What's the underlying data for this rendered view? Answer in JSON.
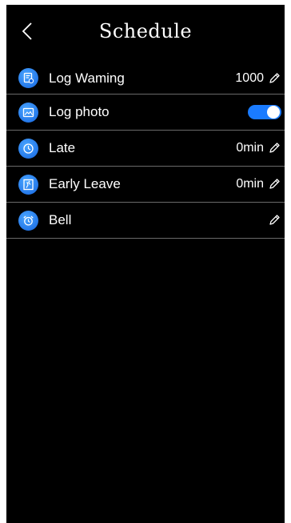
{
  "header": {
    "title": "Schedule",
    "back_icon": "chevron-left-icon"
  },
  "settings": {
    "items": [
      {
        "label": "Log Waming",
        "value": "1000",
        "icon": "log-document-icon",
        "control": "edit-icon"
      },
      {
        "label": "Log photo",
        "toggle_on": true,
        "icon": "photo-icon",
        "control": "toggle"
      },
      {
        "label": "Late",
        "value": "0min",
        "icon": "clock-icon",
        "control": "edit-icon"
      },
      {
        "label": "Early Leave",
        "value": "0min",
        "icon": "exit-door-icon",
        "control": "edit-icon"
      },
      {
        "label": "Bell",
        "value": "",
        "icon": "alarm-clock-icon",
        "control": "edit-icon"
      }
    ]
  },
  "colors": {
    "background": "#000000",
    "accent": "#1a7bff",
    "divider": "#6a6a6a",
    "text": "#ffffff"
  }
}
